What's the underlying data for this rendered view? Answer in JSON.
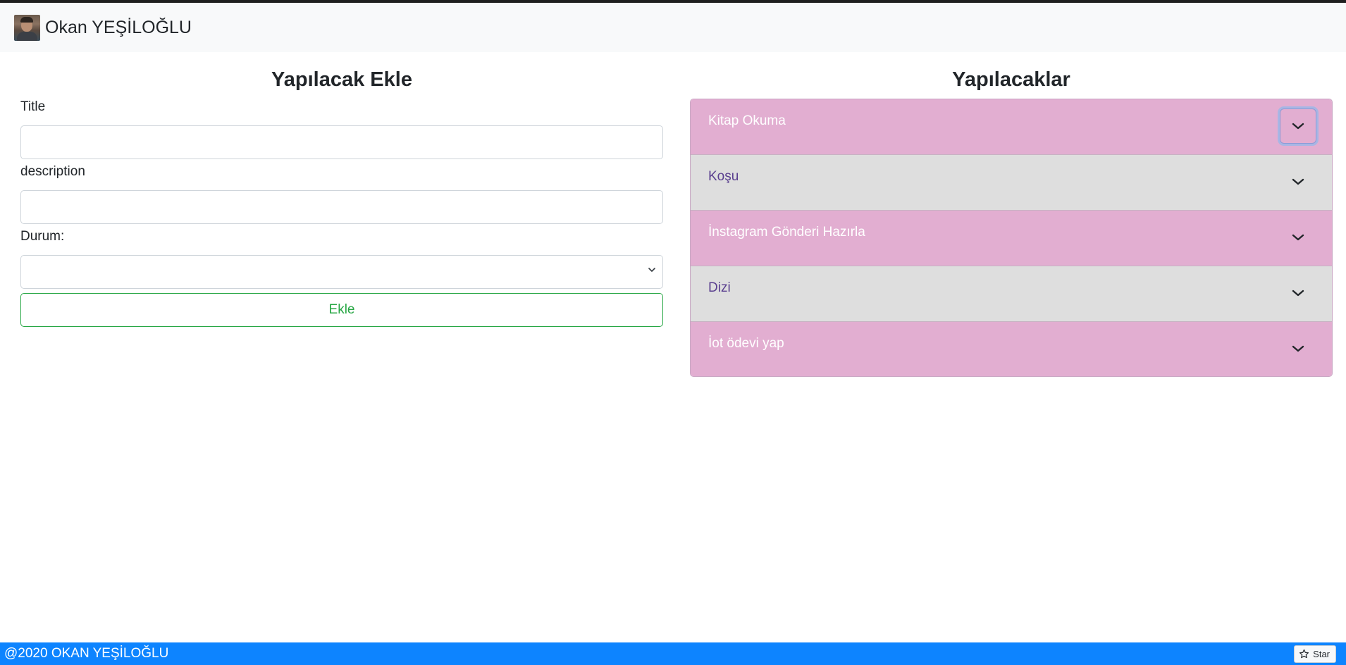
{
  "navbar": {
    "brand": "Okan YEŞİLOĞLU"
  },
  "form": {
    "heading": "Yapılacak Ekle",
    "title_label": "Title",
    "title_value": "",
    "description_label": "description",
    "description_value": "",
    "status_label": "Durum:",
    "status_selected": "",
    "submit_label": "Ekle",
    "submit_color": "#28a745"
  },
  "list": {
    "heading": "Yapılacaklar",
    "items": [
      {
        "label": "Kitap Okuma",
        "style": "pink"
      },
      {
        "label": "Koşu",
        "style": "gray"
      },
      {
        "label": "İnstagram Gönderi Hazırla",
        "style": "pink"
      },
      {
        "label": "Dizi",
        "style": "gray"
      },
      {
        "label": "İot ödevi yap",
        "style": "pink"
      }
    ],
    "colors": {
      "pink": "#e2aed1",
      "gray": "#dedede"
    }
  },
  "footer": {
    "text": "@2020 OKAN YEŞİLOĞLU",
    "star_label": "Star",
    "background": "#0d84ff"
  }
}
